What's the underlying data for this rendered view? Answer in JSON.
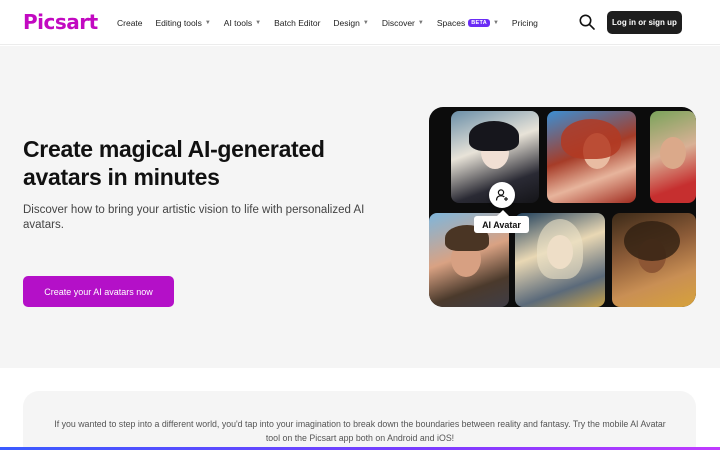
{
  "header": {
    "logo": "Picsart",
    "nav": [
      {
        "label": "Create",
        "has_dropdown": false
      },
      {
        "label": "Editing tools",
        "has_dropdown": true
      },
      {
        "label": "AI tools",
        "has_dropdown": true
      },
      {
        "label": "Batch Editor",
        "has_dropdown": false
      },
      {
        "label": "Design",
        "has_dropdown": true
      },
      {
        "label": "Discover",
        "has_dropdown": true
      },
      {
        "label": "Spaces",
        "has_dropdown": true,
        "badge": "BETA"
      },
      {
        "label": "Pricing",
        "has_dropdown": false
      }
    ],
    "search_icon": "search-icon",
    "login_label": "Log in or sign up"
  },
  "hero": {
    "title": "Create magical AI-generated avatars in minutes",
    "subtitle": "Discover how to bring your artistic vision to life with personalized AI avatars.",
    "cta_label": "Create your AI avatars now",
    "badge_label": "AI Avatar",
    "badge_icon": "user-plus-icon"
  },
  "intro": {
    "text": "If you wanted to step into a different world, you'd tap into your imagination to break down the boundaries between reality and fantasy. Try the mobile AI Avatar tool on the Picsart app both on Android and iOS!"
  },
  "colors": {
    "brand": "#c209c1",
    "cta": "#b410c8",
    "beta": "#6a2cf5",
    "dark_button": "#1e1e1e",
    "hero_bg": "#f5f5f5"
  }
}
